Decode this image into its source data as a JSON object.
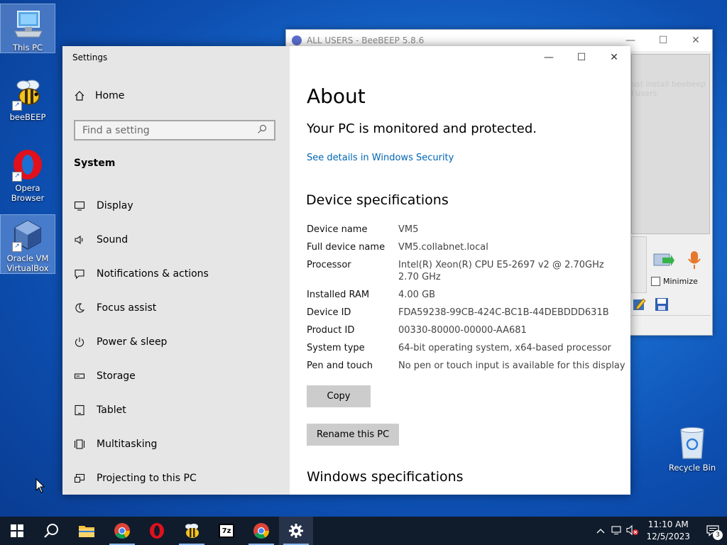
{
  "desktop": {
    "icons": [
      {
        "label": "This PC"
      },
      {
        "label": "beeBEEP"
      },
      {
        "label": "Opera Browser"
      },
      {
        "label": "Oracle VM VirtualBox"
      }
    ],
    "recycle_bin": "Recycle Bin"
  },
  "beebeep": {
    "title": "ALL USERS - BeeBEEP 5.8.6",
    "hint": "ust install beebeep\nl users",
    "minimize_label": "Minimize"
  },
  "settings": {
    "app_title": "Settings",
    "home_label": "Home",
    "search_placeholder": "Find a setting",
    "section": "System",
    "nav_items": [
      {
        "label": "Display",
        "icon": "monitor-icon"
      },
      {
        "label": "Sound",
        "icon": "speaker-icon"
      },
      {
        "label": "Notifications & actions",
        "icon": "notification-icon"
      },
      {
        "label": "Focus assist",
        "icon": "moon-icon"
      },
      {
        "label": "Power & sleep",
        "icon": "power-icon"
      },
      {
        "label": "Storage",
        "icon": "storage-icon"
      },
      {
        "label": "Tablet",
        "icon": "tablet-icon"
      },
      {
        "label": "Multitasking",
        "icon": "multitasking-icon"
      },
      {
        "label": "Projecting to this PC",
        "icon": "projecting-icon"
      }
    ],
    "page_title": "About",
    "protected_text": "Your PC is monitored and protected.",
    "security_link": "See details in Windows Security",
    "device_heading": "Device specifications",
    "specs": [
      {
        "key": "Device name",
        "value": "VM5"
      },
      {
        "key": "Full device name",
        "value": "VM5.collabnet.local"
      },
      {
        "key": "Processor",
        "value": "Intel(R) Xeon(R) CPU E5-2697 v2 @ 2.70GHz\n2.70 GHz"
      },
      {
        "key": "Installed RAM",
        "value": "4.00 GB"
      },
      {
        "key": "Device ID",
        "value": "FDA59238-99CB-424C-BC1B-44DEBDDD631B"
      },
      {
        "key": "Product ID",
        "value": "00330-80000-00000-AA681"
      },
      {
        "key": "System type",
        "value": "64-bit operating system, x64-based processor"
      },
      {
        "key": "Pen and touch",
        "value": "No pen or touch input is available for this display"
      }
    ],
    "copy_button": "Copy",
    "rename_button": "Rename this PC",
    "windows_heading": "Windows specifications"
  },
  "taskbar": {
    "apps": [
      "start",
      "search",
      "file-explorer",
      "chrome",
      "opera",
      "beebeep",
      "7zip",
      "chrome",
      "settings"
    ],
    "sevenzip_label": "7z",
    "time": "11:10 AM",
    "date": "12/5/2023",
    "notification_count": "3"
  },
  "colors": {
    "accent_link": "#0066b4",
    "nav_bg": "#e6e6e6",
    "taskbar_bg": "#101c2c"
  }
}
